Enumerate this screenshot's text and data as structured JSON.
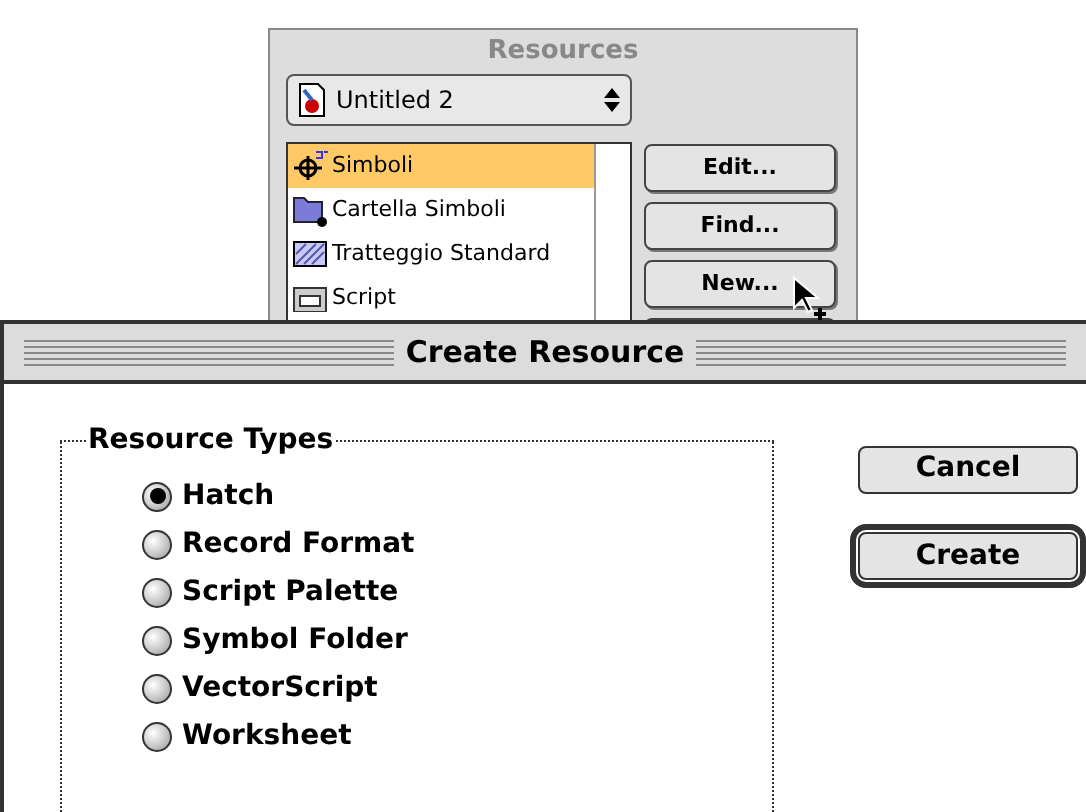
{
  "palette": {
    "title": "Resources",
    "file_popup": "Untitled 2",
    "items": [
      {
        "label": "Simboli",
        "kind": "symbol",
        "selected": true
      },
      {
        "label": "Cartella Simboli",
        "kind": "folder",
        "selected": false
      },
      {
        "label": "Tratteggio Standard",
        "kind": "hatch",
        "selected": false
      },
      {
        "label": "Script",
        "kind": "script",
        "selected": false
      }
    ],
    "buttons": [
      "Edit...",
      "Find...",
      "New..."
    ]
  },
  "dialog": {
    "title": "Create Resource",
    "group_label": "Resource Types",
    "options": [
      {
        "label": "Hatch",
        "selected": true
      },
      {
        "label": "Record Format",
        "selected": false
      },
      {
        "label": "Script Palette",
        "selected": false
      },
      {
        "label": "Symbol Folder",
        "selected": false
      },
      {
        "label": "VectorScript",
        "selected": false
      },
      {
        "label": "Worksheet",
        "selected": false
      }
    ],
    "buttons": [
      {
        "label": "Cancel",
        "default": false
      },
      {
        "label": "Create",
        "default": true
      }
    ]
  }
}
